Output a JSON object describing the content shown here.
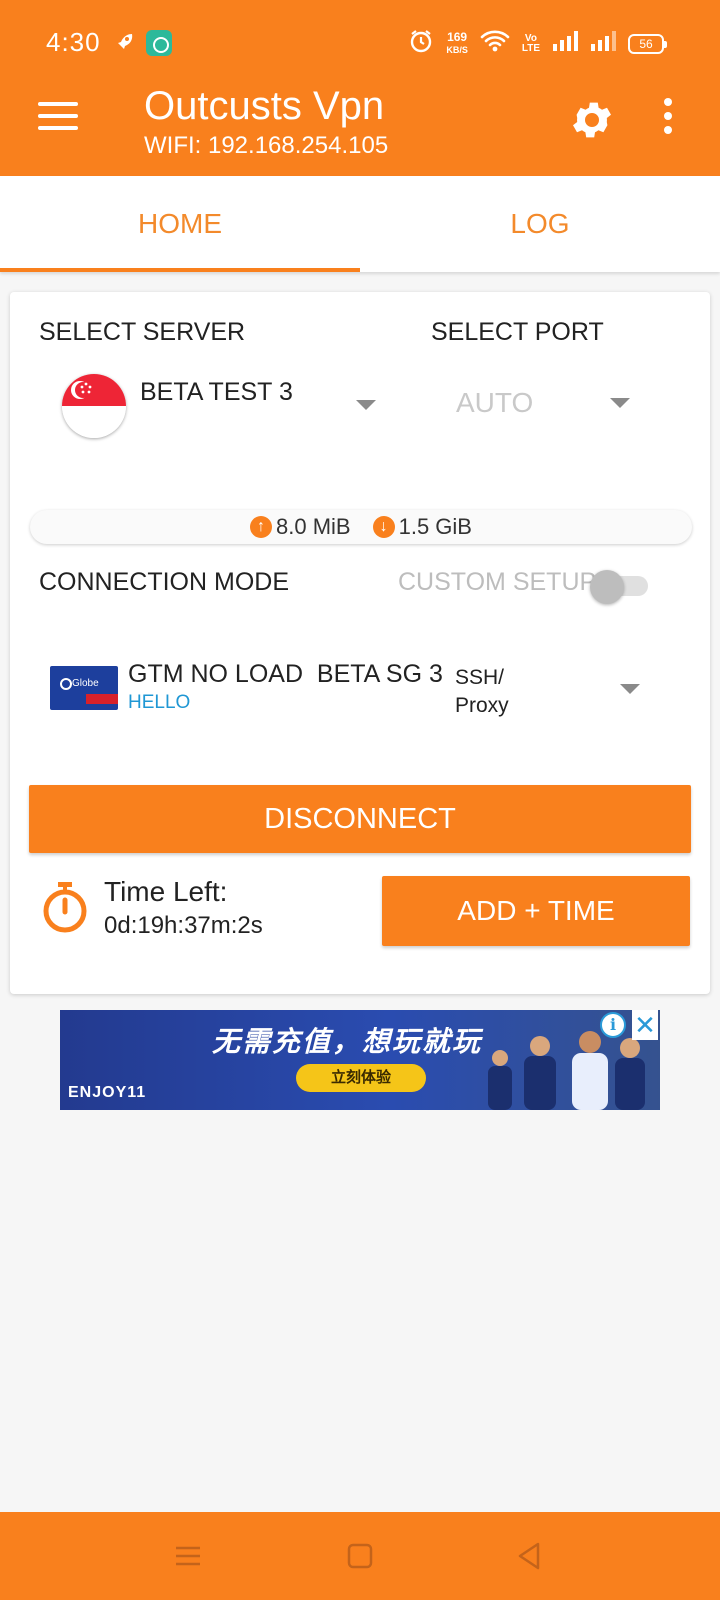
{
  "status_bar": {
    "time": "4:30",
    "net_speed_value": "169",
    "net_speed_unit": "KB/S",
    "volte_line1": "Vo",
    "volte_line2": "LTE",
    "battery": "56"
  },
  "app_bar": {
    "title": "Outcusts Vpn",
    "subtitle": "WIFI: 192.168.254.105"
  },
  "tabs": [
    {
      "label": "HOME",
      "active": true
    },
    {
      "label": "LOG",
      "active": false
    }
  ],
  "server": {
    "section_label": "SELECT SERVER",
    "selected": "BETA TEST 3",
    "flag": "singapore-flag"
  },
  "port": {
    "section_label": "SELECT PORT",
    "selected": "AUTO"
  },
  "traffic": {
    "upload": "8.0 MiB",
    "download": "1.5 GiB"
  },
  "connection": {
    "mode_label": "CONNECTION MODE",
    "custom_setup_label": "CUSTOM SETUP",
    "custom_setup_enabled": false
  },
  "config": {
    "logo_text": "Globe",
    "name": "GTM NO LOAD  BETA SG 3",
    "subtitle": "HELLO",
    "type": "SSH/ Proxy"
  },
  "actions": {
    "disconnect_label": "DISCONNECT",
    "time_left_label": "Time Left:",
    "time_left_value": "0d:19h:37m:2s",
    "add_time_label": "ADD + TIME"
  },
  "ad": {
    "headline": "无需充值，想玩就玩",
    "cta": "立刻体验",
    "brand": "ENJOY11"
  },
  "colors": {
    "accent": "#f9801d",
    "link": "#1f97d4",
    "muted": "#bdbdbd"
  }
}
